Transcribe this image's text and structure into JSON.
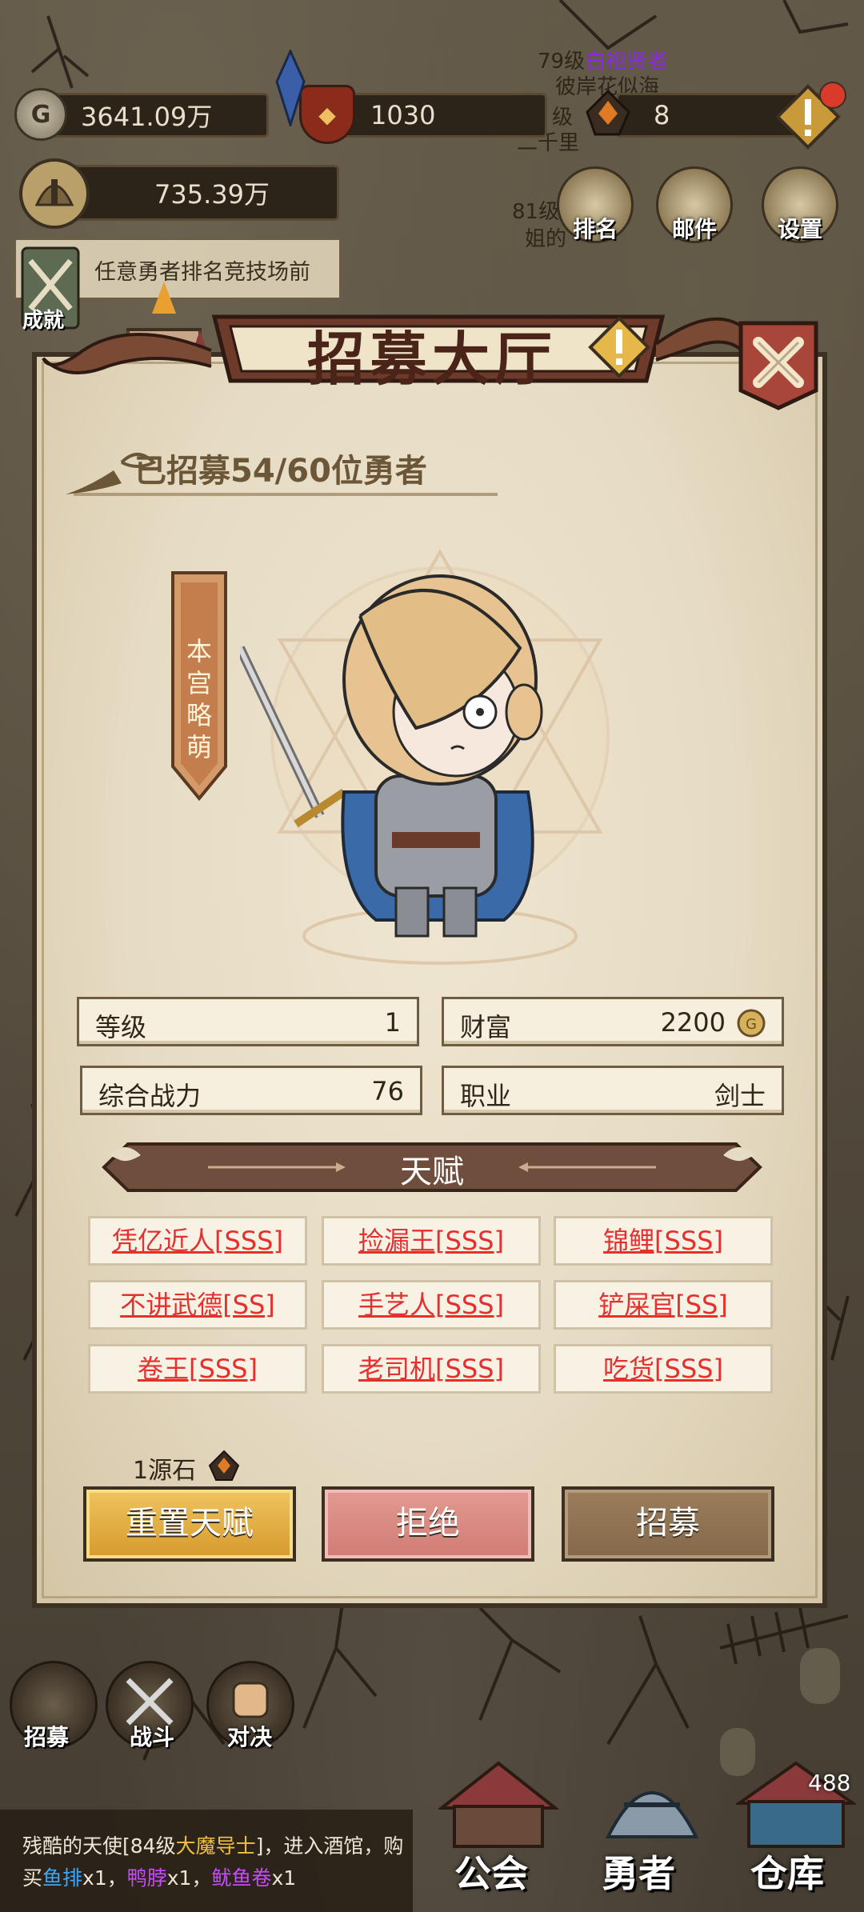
{
  "resources": {
    "gold": "3641.09万",
    "shield": "1030",
    "stone": "8",
    "power": "735.39万"
  },
  "background_labels": {
    "line1_prefix": "79级",
    "line1_class": "白袍贤者",
    "line2": "彼岸花似海",
    "line3": "级",
    "line4": "二千里",
    "line5": "81级",
    "line6": "姐的"
  },
  "top_buttons": {
    "rank": "排名",
    "mail": "邮件",
    "settings": "设置"
  },
  "notice": {
    "text": "任意勇者排名竞技场前",
    "achievement_label": "成就"
  },
  "modal": {
    "title": "招募大厅",
    "recruited_text": "已招募54/60位勇者",
    "hero_tag": "本宫略萌",
    "stats": {
      "level_label": "等级",
      "level_value": "1",
      "wealth_label": "财富",
      "wealth_value": "2200",
      "power_label": "综合战力",
      "power_value": "76",
      "class_label": "职业",
      "class_value": "剑士"
    },
    "talent_heading": "天赋",
    "talents": [
      "凭亿近人[SSS]",
      "捡漏王[SSS]",
      "锦鲤[SSS]",
      "不讲武德[SS]",
      "手艺人[SSS]",
      "铲屎官[SS]",
      "卷王[SSS]",
      "老司机[SSS]",
      "吃货[SSS]"
    ],
    "cost_text": "1源石",
    "buttons": {
      "reset": "重置天赋",
      "reject": "拒绝",
      "recruit": "招募"
    }
  },
  "bottom_left": {
    "recruit": "招募",
    "battle": "战斗",
    "duel": "对决"
  },
  "chat": {
    "prefix": "残酷的天使[84级",
    "class": "大魔导士",
    "mid": "]，进入酒馆，购买",
    "item1": "鱼排",
    "x1a": "x1，",
    "item2": "鸭脖",
    "x1b": "x1，",
    "item3": "鱿鱼卷",
    "x1c": "x1"
  },
  "nav": {
    "guild": "公会",
    "hero": "勇者",
    "warehouse": "仓库",
    "counter": "488"
  },
  "colors": {
    "talent_text": "#e53030",
    "gold_button": "#e2ad45",
    "reject_button": "#d9877f",
    "recruit_button": "#8e7254"
  }
}
